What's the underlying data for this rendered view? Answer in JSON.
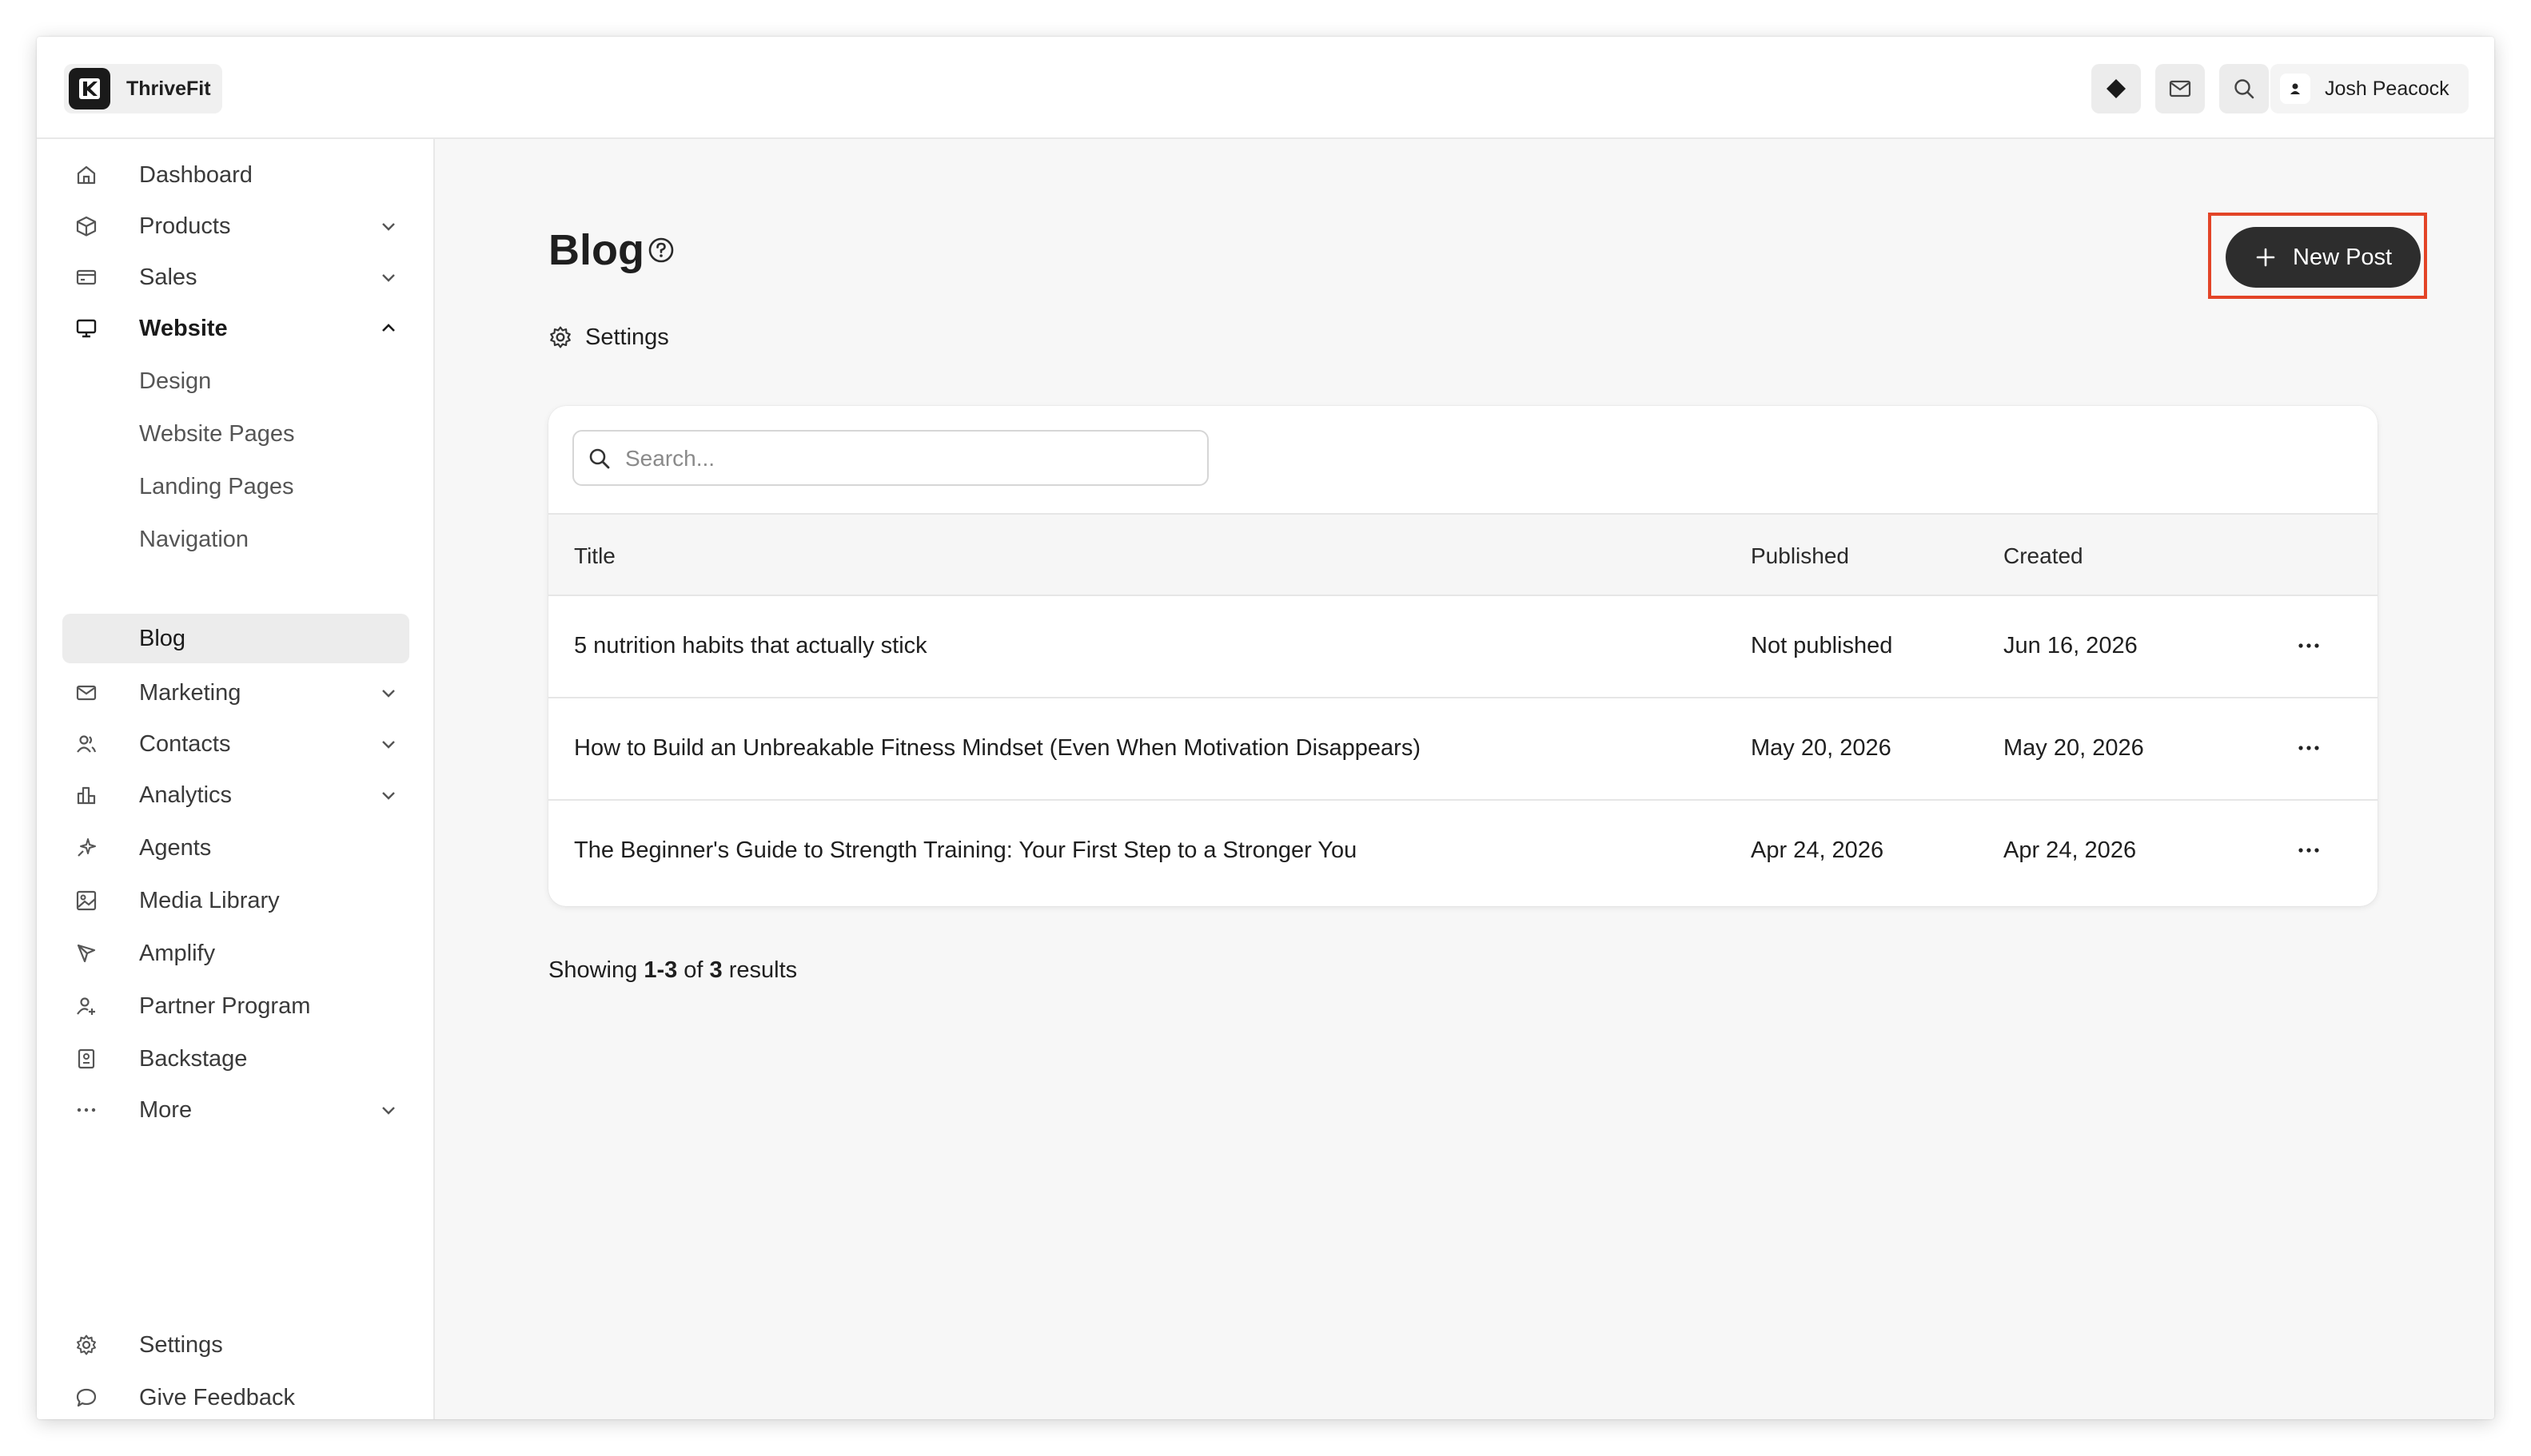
{
  "brand": {
    "name": "ThriveFit"
  },
  "topbar": {
    "icons": [
      "diamond-icon",
      "mail-icon",
      "search-icon"
    ],
    "user_name": "Josh Peacock"
  },
  "sidebar": {
    "items": [
      {
        "label": "Dashboard",
        "icon": "home-icon"
      },
      {
        "label": "Products",
        "icon": "box-icon",
        "chevron": "down"
      },
      {
        "label": "Sales",
        "icon": "credit-card-icon",
        "chevron": "down"
      },
      {
        "label": "Website",
        "icon": "monitor-icon",
        "chevron": "up",
        "bold": true
      },
      {
        "label": "Marketing",
        "icon": "mail-icon",
        "chevron": "down"
      },
      {
        "label": "Contacts",
        "icon": "users-icon",
        "chevron": "down"
      },
      {
        "label": "Analytics",
        "icon": "bar-chart-icon",
        "chevron": "down"
      },
      {
        "label": "Agents",
        "icon": "sparkle-icon"
      },
      {
        "label": "Media Library",
        "icon": "image-icon"
      },
      {
        "label": "Amplify",
        "icon": "send-icon"
      },
      {
        "label": "Partner Program",
        "icon": "partner-icon"
      },
      {
        "label": "Backstage",
        "icon": "badge-icon"
      },
      {
        "label": "More",
        "icon": "more-horizontal-icon",
        "chevron": "down"
      }
    ],
    "website_sub": [
      {
        "label": "Design"
      },
      {
        "label": "Website Pages"
      },
      {
        "label": "Landing Pages"
      },
      {
        "label": "Navigation"
      },
      {
        "label": "Blog",
        "active": true
      }
    ],
    "bottom": [
      {
        "label": "Settings",
        "icon": "gear-icon"
      },
      {
        "label": "Give Feedback",
        "icon": "message-icon"
      }
    ]
  },
  "main": {
    "title": "Blog",
    "settings_label": "Settings",
    "new_post_label": "New Post",
    "search_placeholder": "Search...",
    "table": {
      "headers": [
        "Title",
        "Published",
        "Created"
      ],
      "rows": [
        [
          "5 nutrition habits that actually stick",
          "Not published",
          "Jun 16, 2026"
        ],
        [
          "How to Build an Unbreakable Fitness Mindset (Even When Motivation Disappears)",
          "May 20, 2026",
          "May 20, 2026"
        ],
        [
          "The Beginner's Guide to Strength Training: Your First Step to a Stronger You",
          "Apr 24, 2026",
          "Apr 24, 2026"
        ]
      ]
    },
    "results": {
      "prefix": "Showing",
      "range": "1-3",
      "of": "of",
      "total": "3",
      "suffix": "results"
    }
  },
  "colors": {
    "accent_dark": "#2d2d2d",
    "highlight_frame": "#e34427",
    "main_bg": "#f7f7f7"
  }
}
